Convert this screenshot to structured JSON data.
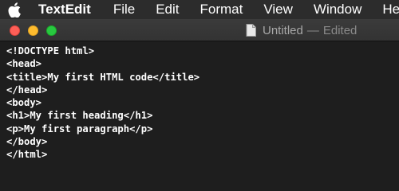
{
  "menubar": {
    "app_name": "TextEdit",
    "items": [
      "File",
      "Edit",
      "Format",
      "View",
      "Window",
      "Help"
    ],
    "apple_icon": "apple-logo-icon"
  },
  "window": {
    "controls": {
      "close_color": "#fe5f57",
      "minimize_color": "#febc2e",
      "zoom_color": "#28c840"
    },
    "title": "Untitled",
    "separator": "—",
    "status": "Edited",
    "doc_icon": "document-icon"
  },
  "editor": {
    "lines": [
      "<!DOCTYPE html>",
      "<head>",
      "<title>My first HTML code</title>",
      "</head>",
      "<body>",
      "<h1>My first heading</h1>",
      "<p>My first paragraph</p>",
      "</body>",
      "</html>"
    ]
  }
}
